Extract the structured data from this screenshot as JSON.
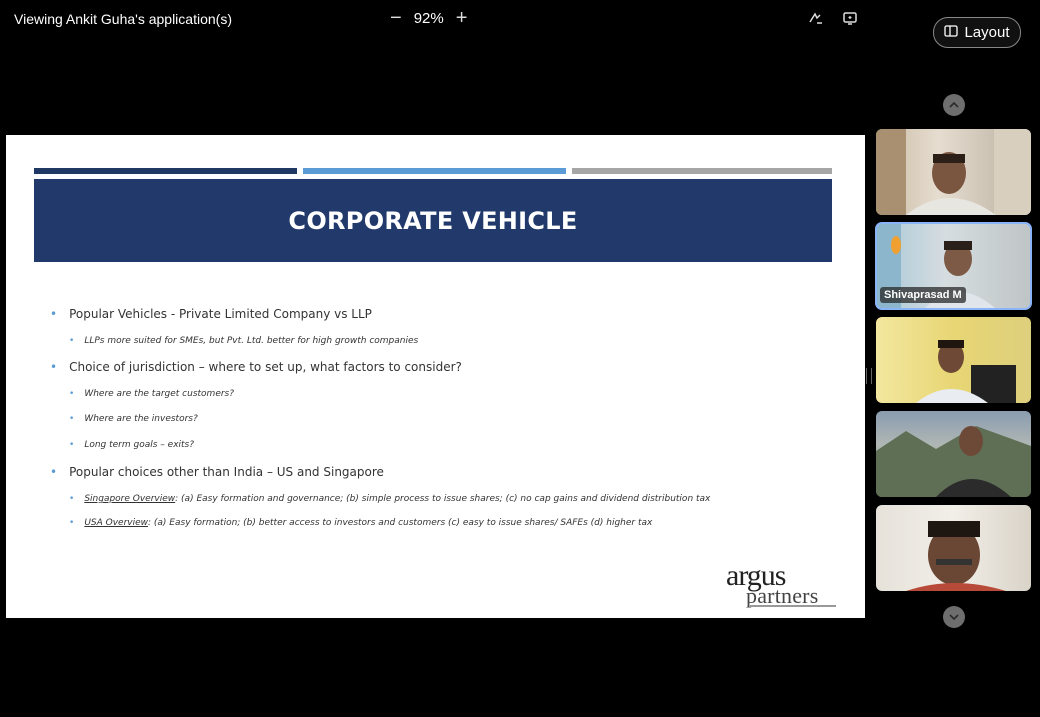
{
  "viewing_label": "Viewing Ankit Guha's application(s)",
  "zoom": {
    "minus": "−",
    "value": "92%",
    "plus": "+"
  },
  "topbar_icons": [
    "annotate-icon",
    "popout-screen-icon"
  ],
  "layout_button": {
    "label": "Layout",
    "icon": "layout-icon"
  },
  "slide": {
    "title": "CORPORATE VEHICLE",
    "bullets": [
      {
        "level": 1,
        "text": "Popular Vehicles - Private Limited Company vs LLP"
      },
      {
        "level": 2,
        "text": "LLPs more suited for SMEs, but Pvt. Ltd. better for high growth companies"
      },
      {
        "level": 1,
        "text": "Choice of jurisdiction – where to set up, what factors to consider?"
      },
      {
        "level": 2,
        "text": "Where are the target customers?"
      },
      {
        "level": 2,
        "text": "Where are the investors?"
      },
      {
        "level": 2,
        "text": "Long term goals – exits?"
      },
      {
        "level": 1,
        "text": "Popular choices other than India – US and Singapore"
      },
      {
        "level": 2,
        "underline": "Singapore Overview",
        "text": ": (a) Easy formation and governance; (b) simple process to issue shares; (c) no cap gains and dividend distribution tax"
      },
      {
        "level": 2,
        "underline": "USA Overview",
        "text": ": (a) Easy formation; (b) better access to investors and customers (c) easy to issue shares/ SAFEs (d) higher tax"
      }
    ],
    "logo": {
      "main": "argus",
      "sub": "partners"
    }
  },
  "participants": [
    {
      "name": "",
      "active": false
    },
    {
      "name": "Shivaprasad M",
      "active": true
    },
    {
      "name": "",
      "active": false
    },
    {
      "name": "",
      "active": false
    },
    {
      "name": "",
      "active": false
    }
  ],
  "colors": {
    "banner": "#213a6b",
    "bullet": "#5b9bd5",
    "active_tile": "#8ab4f8"
  }
}
